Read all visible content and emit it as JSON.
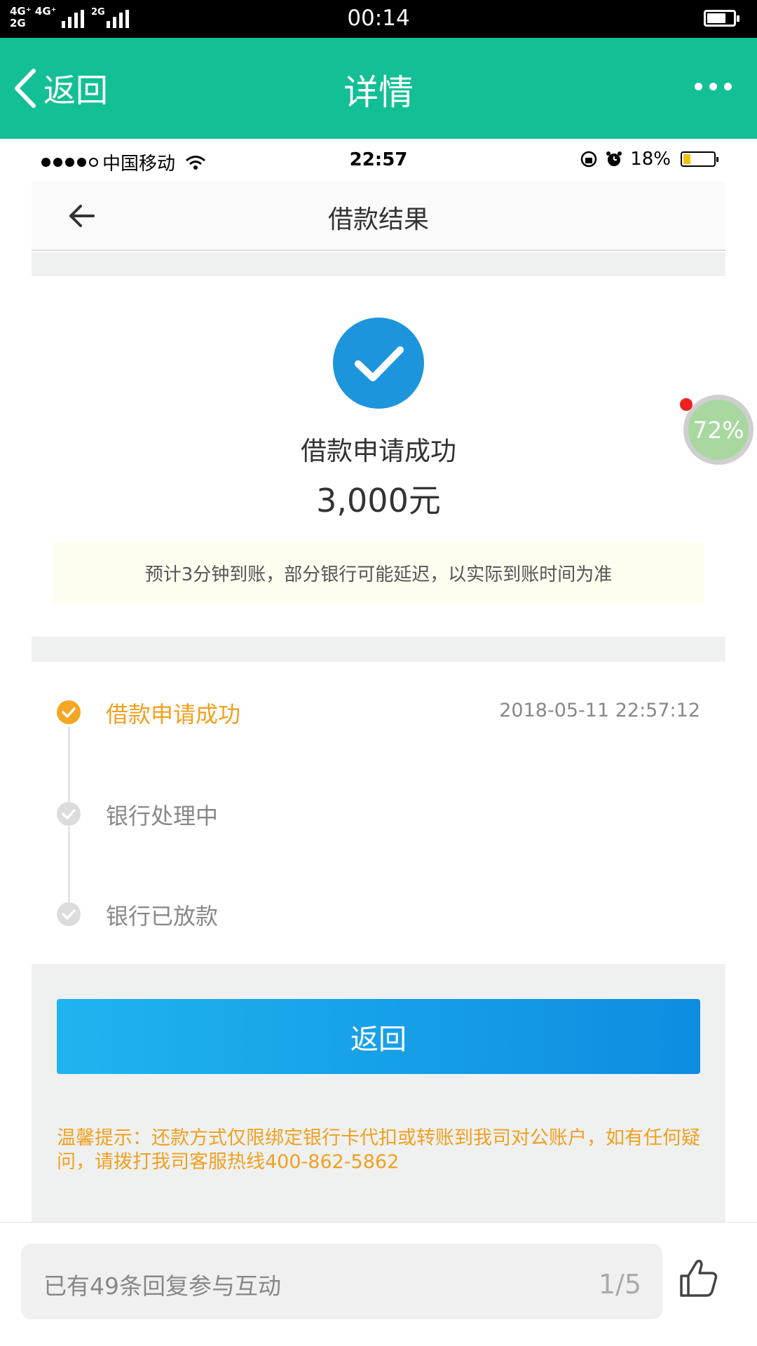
{
  "os_status": {
    "network_top": "4G⁺ 4G⁺",
    "network_bottom": "2G",
    "sim2": "2G",
    "time": "00:14"
  },
  "app_header": {
    "back_label": "返回",
    "title": "详情"
  },
  "screenshot": {
    "status": {
      "carrier": "中国移动",
      "time": "22:57",
      "battery": "18%"
    },
    "nav_title": "借款结果",
    "result_title": "借款申请成功",
    "amount": "3,000元",
    "notice": "预计3分钟到账，部分银行可能延迟，以实际到账时间为准",
    "timeline": [
      {
        "label": "借款申请成功",
        "time": "2018-05-11 22:57:12",
        "state": "done"
      },
      {
        "label": "银行处理中",
        "state": "pending"
      },
      {
        "label": "银行已放款",
        "state": "pending"
      }
    ],
    "return_button": "返回",
    "tip": "温馨提示：还款方式仅限绑定银行卡代扣或转账到我司对公账户，如有任何疑问，请拨打我司客服热线400-862-5862"
  },
  "float_badge": "72%",
  "reply_bar": {
    "placeholder": "已有49条回复参与互动",
    "page": "1/5"
  },
  "colors": {
    "header_green": "#13bf95",
    "success_blue": "#1c95dd",
    "timeline_orange": "#f5a623",
    "tip_orange": "#f0a020"
  }
}
